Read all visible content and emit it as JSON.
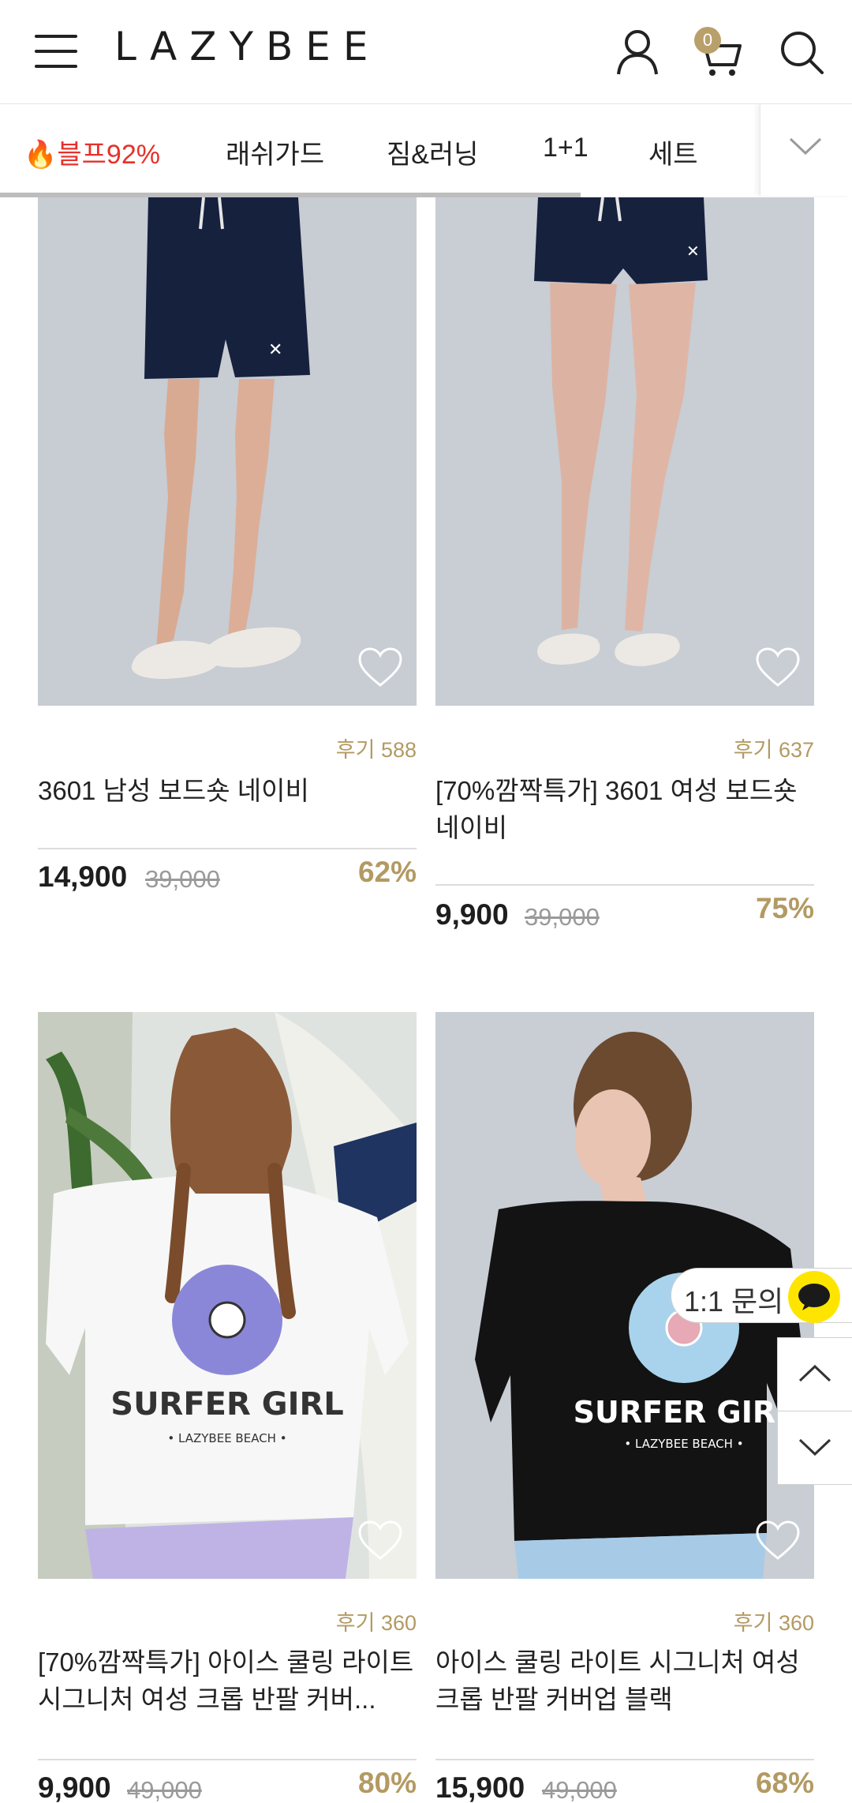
{
  "header": {
    "logo": "LAZYBEE",
    "cart_count": "0",
    "icons": [
      "menu-icon",
      "user-icon",
      "cart-icon",
      "search-icon"
    ]
  },
  "tabs": {
    "items": [
      {
        "label": "블프92%",
        "hot": true
      },
      {
        "label": "래쉬가드"
      },
      {
        "label": "짐&러닝"
      },
      {
        "label": "1+1"
      },
      {
        "label": "세트"
      }
    ],
    "expand_icon": "chevron-down-icon"
  },
  "products": [
    {
      "review": "후기 588",
      "name": "3601 남성 보드숏 네이비",
      "price": "14,900",
      "original_price": "39,000",
      "discount": "62%"
    },
    {
      "review": "후기 637",
      "name": "[70%깜짝특가] 3601 여성 보드숏 네이비",
      "price": "9,900",
      "original_price": "39,000",
      "discount": "75%"
    },
    {
      "review": "후기 360",
      "name": "[70%깜짝특가] 아이스 쿨링 라이트 시그니처 여성 크롭 반팔 커버...",
      "price": "9,900",
      "original_price": "49,000",
      "discount": "80%",
      "print_title": "SURFER GIRL",
      "print_sub": "• LAZYBEE BEACH •"
    },
    {
      "review": "후기 360",
      "name": "아이스 쿨링 라이트 시그니처 여성 크롭 반팔 커버업 블랙",
      "price": "15,900",
      "original_price": "49,000",
      "discount": "68%",
      "print_title": "SURFER GIRL",
      "print_sub": "• LAZYBEE BEACH •"
    }
  ],
  "floating": {
    "inquiry_label": "1:1 문의",
    "inquiry_icon": "kakao-chat-icon",
    "scroll_up_icon": "chevron-up-icon",
    "scroll_down_icon": "chevron-down-icon"
  },
  "colors": {
    "accent_gold": "#b39a63",
    "hot_red": "#e6312a",
    "kakao_yellow": "#fee500",
    "photo_bg": "#c9cdd4"
  }
}
